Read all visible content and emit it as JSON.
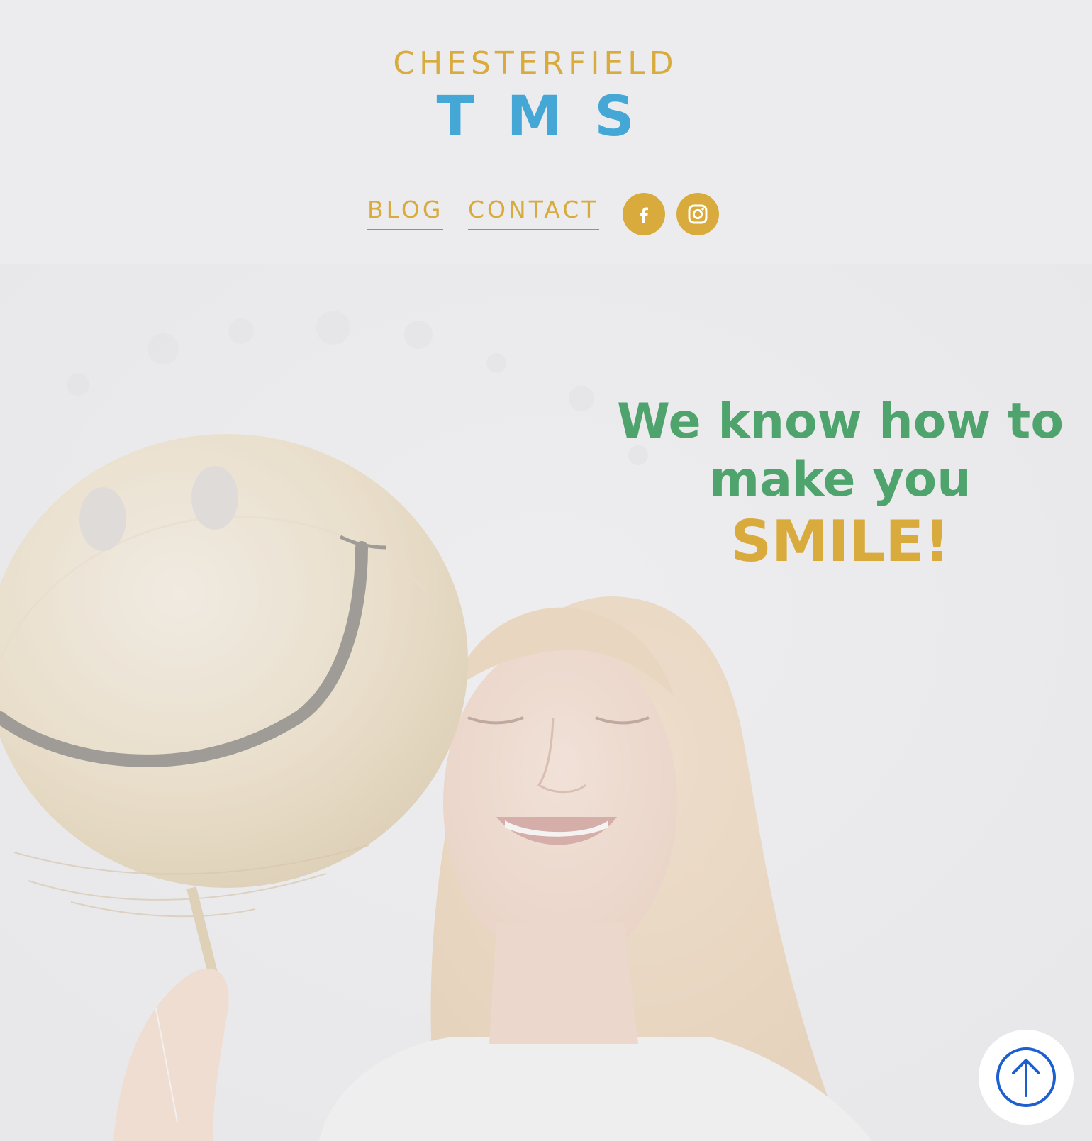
{
  "brand": {
    "line1": "CHESTERFIELD",
    "line2": "TMS"
  },
  "nav": {
    "items": [
      {
        "label": "BLOG"
      },
      {
        "label": "CONTACT"
      }
    ],
    "social": [
      {
        "icon": "facebook-icon"
      },
      {
        "icon": "instagram-icon"
      }
    ]
  },
  "hero": {
    "line1": "We know how to",
    "line2": "make you",
    "line3": "SMILE!"
  },
  "colors": {
    "gold": "#d8ab3c",
    "blue": "#45a7d6",
    "green": "#4ea46c",
    "scroll_blue": "#1d5fcf"
  },
  "scroll_top": {
    "icon": "arrow-up-circle-icon"
  }
}
